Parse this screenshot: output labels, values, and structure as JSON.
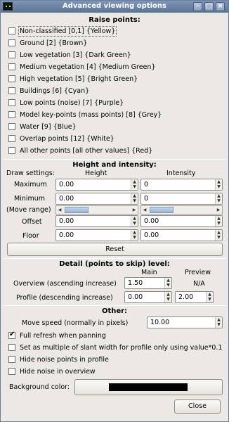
{
  "window": {
    "title": "Advanced viewing options"
  },
  "raise": {
    "title": "Raise points:",
    "items": [
      {
        "label": "Non-classified [0,1] {Yellow}",
        "checked": false
      },
      {
        "label": "Ground [2] {Brown}",
        "checked": false
      },
      {
        "label": "Low vegetation [3] {Dark Green}",
        "checked": false
      },
      {
        "label": "Medium vegetation [4] {Medium Green}",
        "checked": false
      },
      {
        "label": "High vegetation [5] {Bright Green}",
        "checked": false
      },
      {
        "label": "Buildings [6] {Cyan}",
        "checked": false
      },
      {
        "label": "Low points (noise) [7] {Purple}",
        "checked": false
      },
      {
        "label": "Model key-points (mass points) [8] {Grey}",
        "checked": false
      },
      {
        "label": "Water [9] {Blue}",
        "checked": false
      },
      {
        "label": "Overlap points [12] {White}",
        "checked": false
      },
      {
        "label": "All other points [all other values] {Red}",
        "checked": false
      }
    ]
  },
  "height": {
    "title": "Height and intensity:",
    "draw_settings": "Draw settings:",
    "col_height": "Height",
    "col_intensity": "Intensity",
    "maximum": "Maximum",
    "minimum": "Minimum",
    "move_range": "(Move range)",
    "offset": "Offset",
    "floor": "Floor",
    "max_height": "0.00",
    "max_intensity": "0",
    "min_height": "0.00",
    "min_intensity": "0",
    "offset_height": "0.00",
    "offset_intensity": "0.00",
    "floor_height": "0.00",
    "floor_intensity": "0.00",
    "reset": "Reset"
  },
  "detail": {
    "title": "Detail (points to skip) level:",
    "col_main": "Main",
    "col_preview": "Preview",
    "overview": "Overview (ascending increase)",
    "profile": "Profile (descending increase)",
    "overview_main": "1.50",
    "overview_preview": "N/A",
    "profile_main": "0.00",
    "profile_preview": "2.00"
  },
  "other": {
    "title": "Other:",
    "move_speed_label": "Move speed (normally in pixels)",
    "move_speed": "10.00",
    "options": [
      {
        "label": "Full refresh when panning",
        "checked": true
      },
      {
        "label": "Set as multiple of slant width for profile only using value*0.1",
        "checked": false
      },
      {
        "label": "Hide noise points in profile",
        "checked": false
      },
      {
        "label": "Hide noise in overview",
        "checked": false
      }
    ],
    "background_label": "Background color:",
    "background_color": "#000000",
    "close": "Close"
  }
}
